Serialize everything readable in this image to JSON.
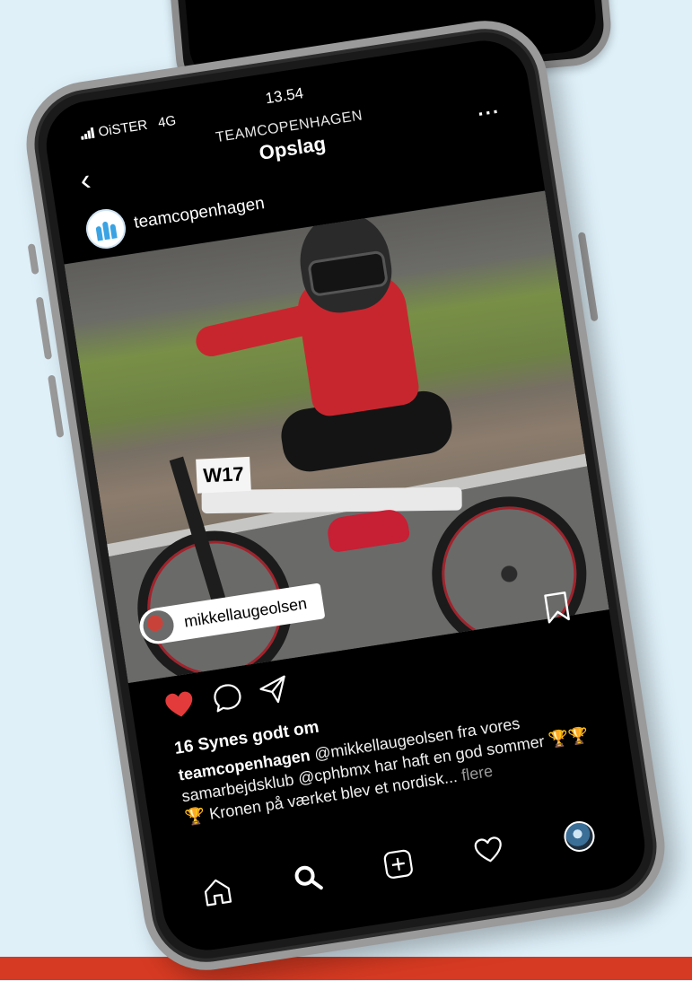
{
  "status_bar": {
    "carrier": "OiSTER",
    "network": "4G",
    "time": "13.54"
  },
  "nav": {
    "back_glyph": "‹",
    "subtitle": "TEAMCOPENHAGEN",
    "title": "Opslag",
    "more_glyph": "···"
  },
  "post": {
    "username": "teamcopenhagen",
    "photo_plate": "W17",
    "tagged_user": "mikkellaugeolsen",
    "liked": true,
    "likes": "16 Synes godt om",
    "caption_user": "teamcopenhagen",
    "caption_text": "@mikkellaugeolsen fra vores samarbejdsklub @cphbmx har haft en god sommer",
    "caption_trophies": "🏆🏆🏆",
    "caption_tail": "Kronen på værket blev et nordisk...",
    "caption_more": "flere"
  },
  "colors": {
    "like_red": "#e33b3b",
    "background": "#dff0f9",
    "accent_band": "#d73a22"
  },
  "icons": [
    "back-icon",
    "more-icon",
    "heart-icon",
    "comment-icon",
    "share-icon",
    "bookmark-icon",
    "home-icon",
    "search-icon",
    "add-icon",
    "activity-icon",
    "profile-avatar"
  ]
}
